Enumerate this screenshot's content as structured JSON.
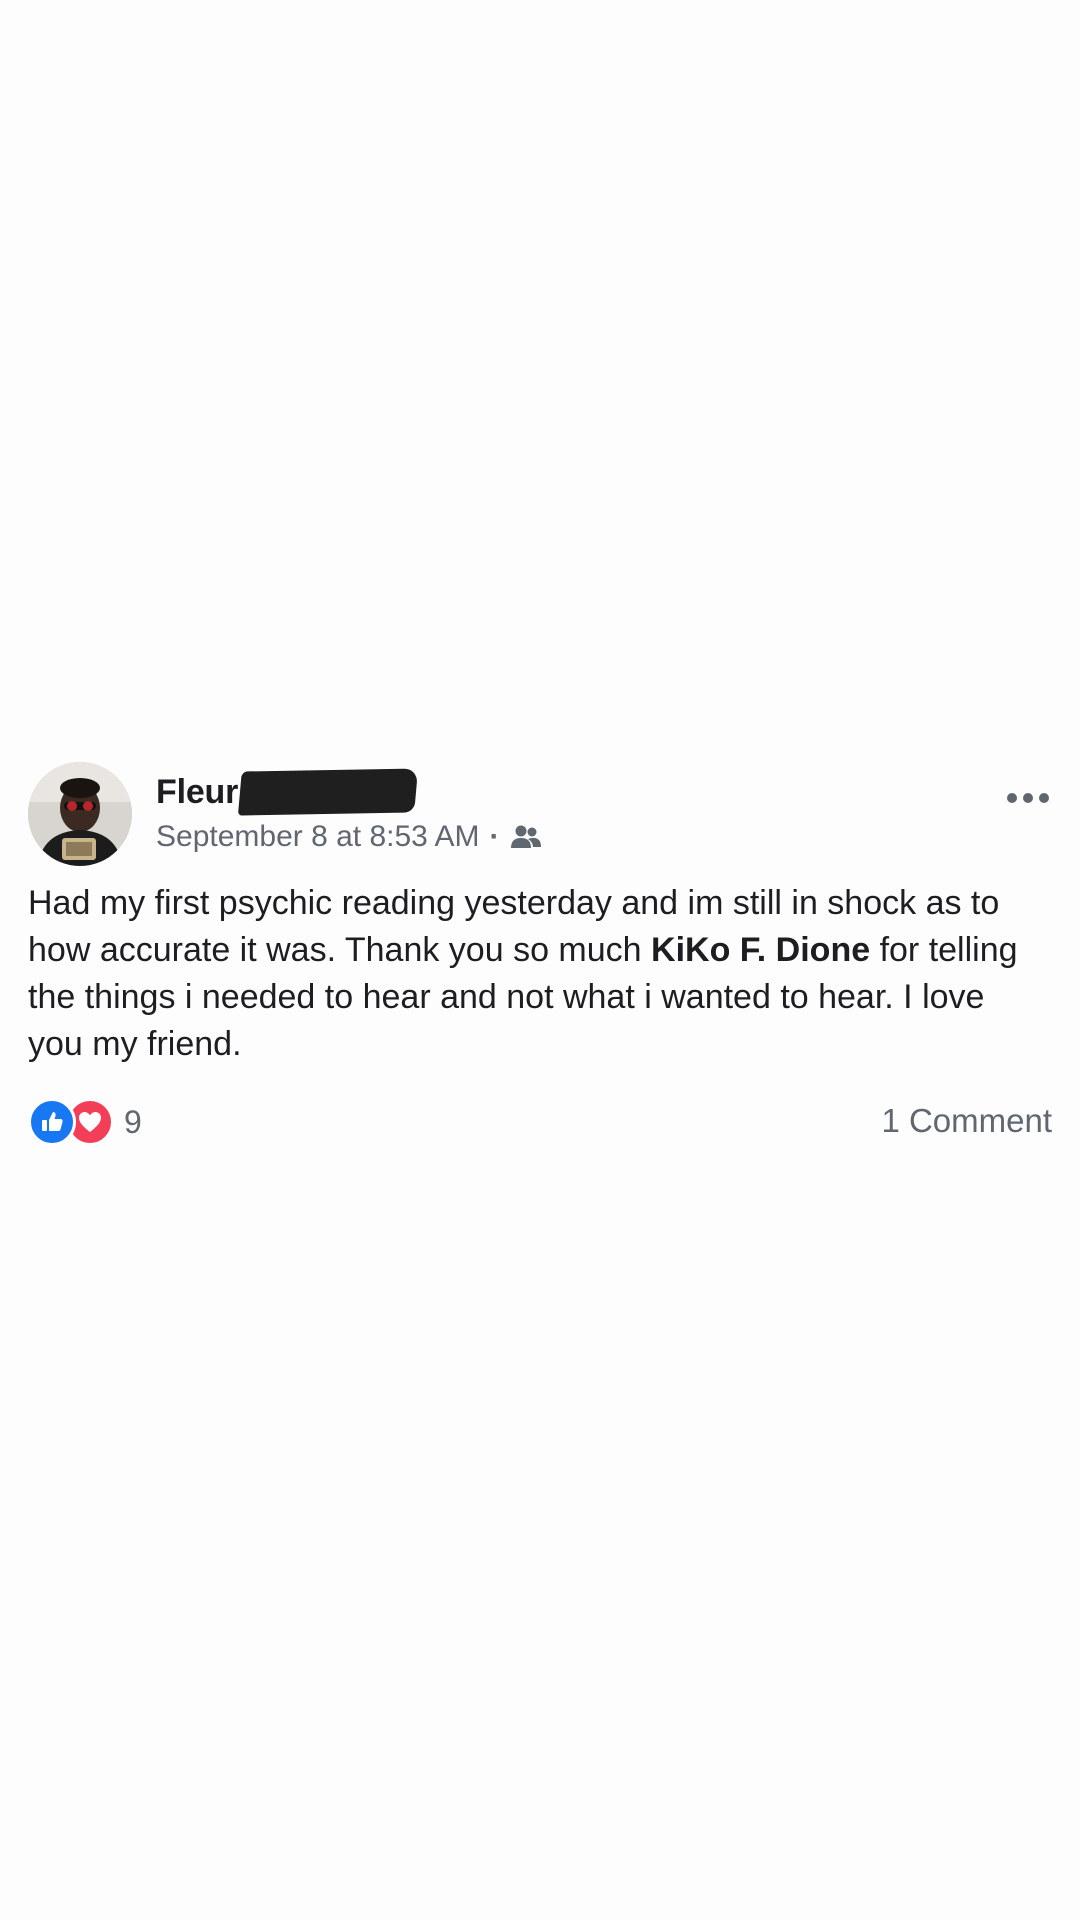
{
  "post": {
    "author": {
      "name_visible": "Fleur",
      "name_redacted": true
    },
    "timestamp": "September 8 at 8:53 AM",
    "separator": "·",
    "audience_icon": "friends-icon",
    "more_icon": "more-options-icon",
    "text_before_mention": "Had my first psychic reading yesterday and im still in shock as to how accurate it was. Thank you so much ",
    "mention": "KiKo F. Dione",
    "text_after_mention": " for telling the things i needed to hear and not what i wanted to hear. I love you my friend.",
    "reactions": {
      "icons": [
        "like-icon",
        "love-icon"
      ],
      "count": "9"
    },
    "comments_label": "1 Comment"
  },
  "colors": {
    "background": "#fefdfd",
    "text_primary": "#1c1e21",
    "text_secondary": "#606770",
    "like_blue": "#1877f2",
    "love_red": "#f33e58"
  }
}
